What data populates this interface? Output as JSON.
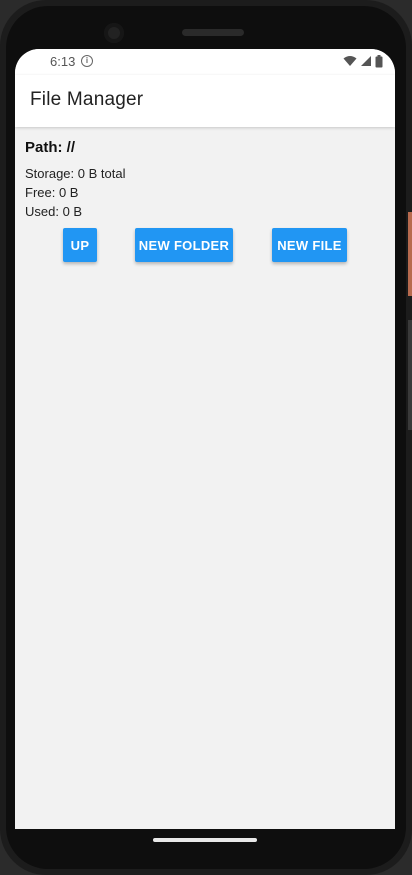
{
  "status_bar": {
    "time": "6:13",
    "icons": [
      "info-icon",
      "wifi-icon",
      "signal-icon",
      "battery-icon"
    ]
  },
  "app_bar": {
    "title": "File Manager"
  },
  "content": {
    "path": "Path: //",
    "storage": "Storage: 0 B total",
    "free": "Free: 0 B",
    "used": "Used: 0 B"
  },
  "buttons": {
    "up": "UP",
    "new_folder": "NEW FOLDER",
    "new_file": "NEW FILE"
  },
  "colors": {
    "accent": "#2196f3",
    "background": "#f2f2f2",
    "app_bar": "#ffffff"
  }
}
